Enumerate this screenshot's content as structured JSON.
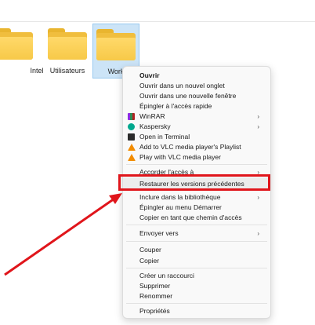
{
  "folders": [
    {
      "label": "Intel"
    },
    {
      "label": "Utilisateurs"
    },
    {
      "label": "Work"
    }
  ],
  "menu": {
    "open": "Ouvrir",
    "open_new_tab": "Ouvrir dans un nouvel onglet",
    "open_new_window": "Ouvrir dans une nouvelle fenêtre",
    "pin_quick_access": "Épingler à l'accès rapide",
    "winrar": "WinRAR",
    "kaspersky": "Kaspersky",
    "open_terminal": "Open in Terminal",
    "vlc_playlist": "Add to VLC media player's Playlist",
    "vlc_play": "Play with VLC media player",
    "grant_access": "Accorder l'accès à",
    "restore_versions": "Restaurer les versions précédentes",
    "include_library": "Inclure dans la bibliothèque",
    "pin_start": "Épingler au menu Démarrer",
    "copy_path": "Copier en tant que chemin d'accès",
    "send_to": "Envoyer vers",
    "cut": "Couper",
    "copy": "Copier",
    "create_shortcut": "Créer un raccourci",
    "delete": "Supprimer",
    "rename": "Renommer",
    "properties": "Propriétés"
  },
  "colors": {
    "highlight_box": "#e0151b",
    "folder": "#f7c948",
    "selection": "#cce4f7"
  }
}
